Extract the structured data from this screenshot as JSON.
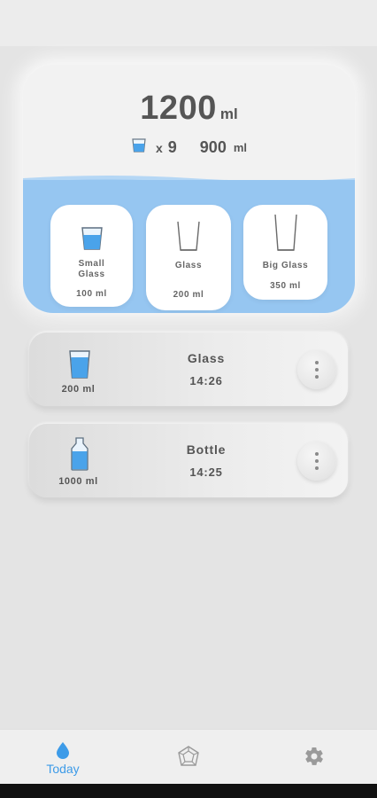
{
  "summary": {
    "total_value": "1200",
    "total_unit": "ml",
    "count_prefix": "x",
    "count": "9",
    "volume_value": "900",
    "volume_unit": "ml"
  },
  "presets": [
    {
      "label": "Small\nGlass",
      "volume": "100 ml",
      "icon": "small-glass-icon"
    },
    {
      "label": "Glass",
      "volume": "200 ml",
      "icon": "glass-icon"
    },
    {
      "label": "Big Glass",
      "volume": "350 ml",
      "icon": "big-glass-icon"
    }
  ],
  "entries": [
    {
      "title": "Glass",
      "time": "14:26",
      "volume": "200 ml",
      "icon": "glass-icon"
    },
    {
      "title": "Bottle",
      "time": "14:25",
      "volume": "1000 ml",
      "icon": "bottle-icon"
    }
  ],
  "nav": {
    "today_label": "Today",
    "items": [
      "water-drop-icon",
      "stats-icon",
      "gear-icon"
    ]
  },
  "colors": {
    "accent": "#3d9be8",
    "water": "#96c6f1",
    "background": "#e4e4e4"
  }
}
